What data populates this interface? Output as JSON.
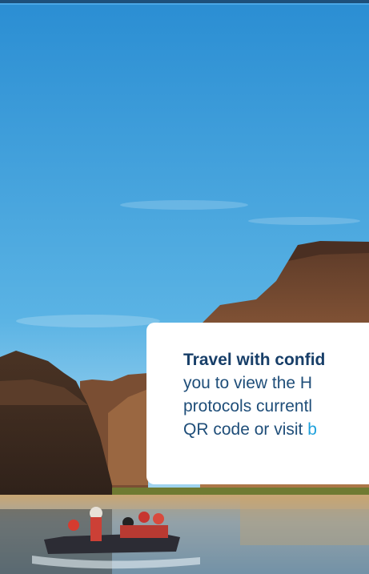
{
  "card": {
    "heading": "Travel with confid",
    "lines": [
      "you to view the H",
      "protocols currentl",
      "QR code or visit "
    ],
    "link_text": "b"
  },
  "colors": {
    "sky": "#2f97d6",
    "card_bg": "#ffffff",
    "text": "#1f4e79",
    "link": "#1ea1dc"
  }
}
